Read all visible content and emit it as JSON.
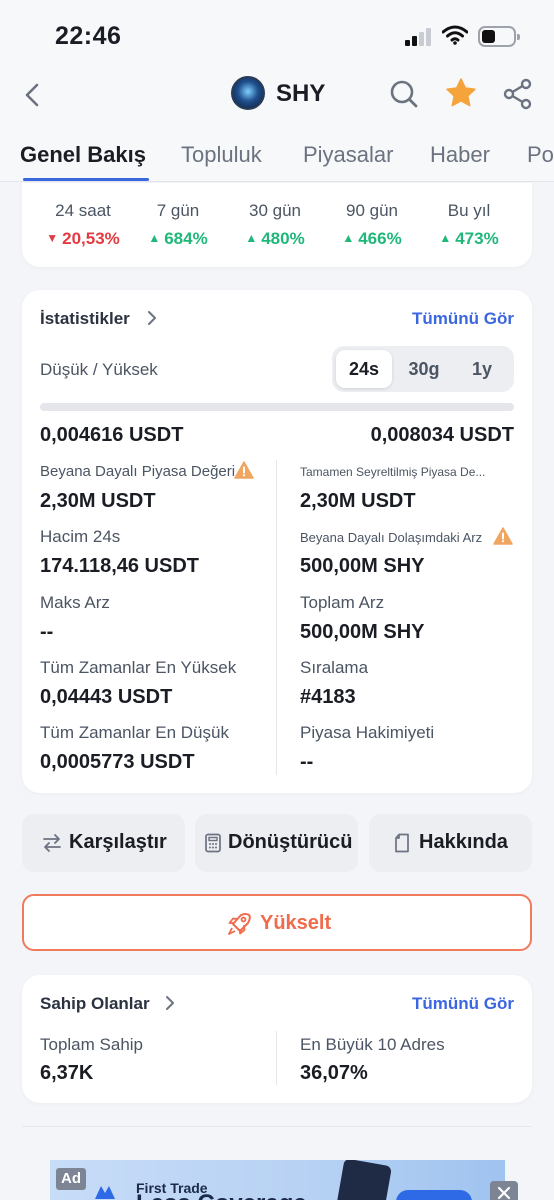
{
  "status_bar": {
    "time": "22:46"
  },
  "header": {
    "token_name": "SHY"
  },
  "tabs": [
    {
      "label": "Genel Bakış",
      "active": true
    },
    {
      "label": "Topluluk",
      "active": false
    },
    {
      "label": "Piyasalar",
      "active": false
    },
    {
      "label": "Haber",
      "active": false
    },
    {
      "label": "Po",
      "active": false
    }
  ],
  "performance": [
    {
      "label": "24 saat",
      "value": "20,53%",
      "direction": "down"
    },
    {
      "label": "7 gün",
      "value": "684%",
      "direction": "up"
    },
    {
      "label": "30 gün",
      "value": "480%",
      "direction": "up"
    },
    {
      "label": "90 gün",
      "value": "466%",
      "direction": "up"
    },
    {
      "label": "Bu yıl",
      "value": "473%",
      "direction": "up"
    }
  ],
  "stats": {
    "title": "İstatistikler",
    "see_all": "Tümünü Gör",
    "low_high_label": "Düşük / Yüksek",
    "periods": [
      "24s",
      "30g",
      "1y"
    ],
    "selected_period": "24s",
    "low": "0,004616 USDT",
    "high": "0,008034 USDT",
    "left": [
      {
        "label": "Beyana Dayalı Piyasa Değeri",
        "value": "2,30M USDT"
      },
      {
        "label": "Hacim 24s",
        "value": "174.118,46 USDT"
      },
      {
        "label": "Maks Arz",
        "value": "--"
      },
      {
        "label": "Tüm Zamanlar En Yüksek",
        "value": "0,04443 USDT"
      },
      {
        "label": "Tüm Zamanlar En Düşük",
        "value": "0,0005773 USDT"
      }
    ],
    "right": [
      {
        "label": "Tamamen Seyreltilmiş Piyasa De...",
        "value": "2,30M USDT"
      },
      {
        "label": "Beyana Dayalı Dolaşımdaki Arz",
        "value": "500,00M SHY"
      },
      {
        "label": "Toplam Arz",
        "value": "500,00M SHY"
      },
      {
        "label": "Sıralama",
        "value": "#4183"
      },
      {
        "label": "Piyasa Hakimiyeti",
        "value": "--"
      }
    ]
  },
  "actions": {
    "compare": "Karşılaştır",
    "converter": "Dönüştürücü",
    "about": "Hakkında",
    "boost": "Yükselt"
  },
  "holders": {
    "title": "Sahip Olanlar",
    "see_all": "Tümünü Gör",
    "total_label": "Toplam Sahip",
    "total_value": "6,37K",
    "top10_label": "En Büyük 10 Adres",
    "top10_value": "36,07%"
  },
  "ad": {
    "tag": "Ad",
    "title": "First Trade",
    "headline": "Less Coverage"
  },
  "colors": {
    "accent": "#3a66e0",
    "up": "#1fb87a",
    "down": "#e23b42",
    "boost": "#ef6b4b",
    "star": "#f5a33b",
    "warning": "#f0a561"
  }
}
